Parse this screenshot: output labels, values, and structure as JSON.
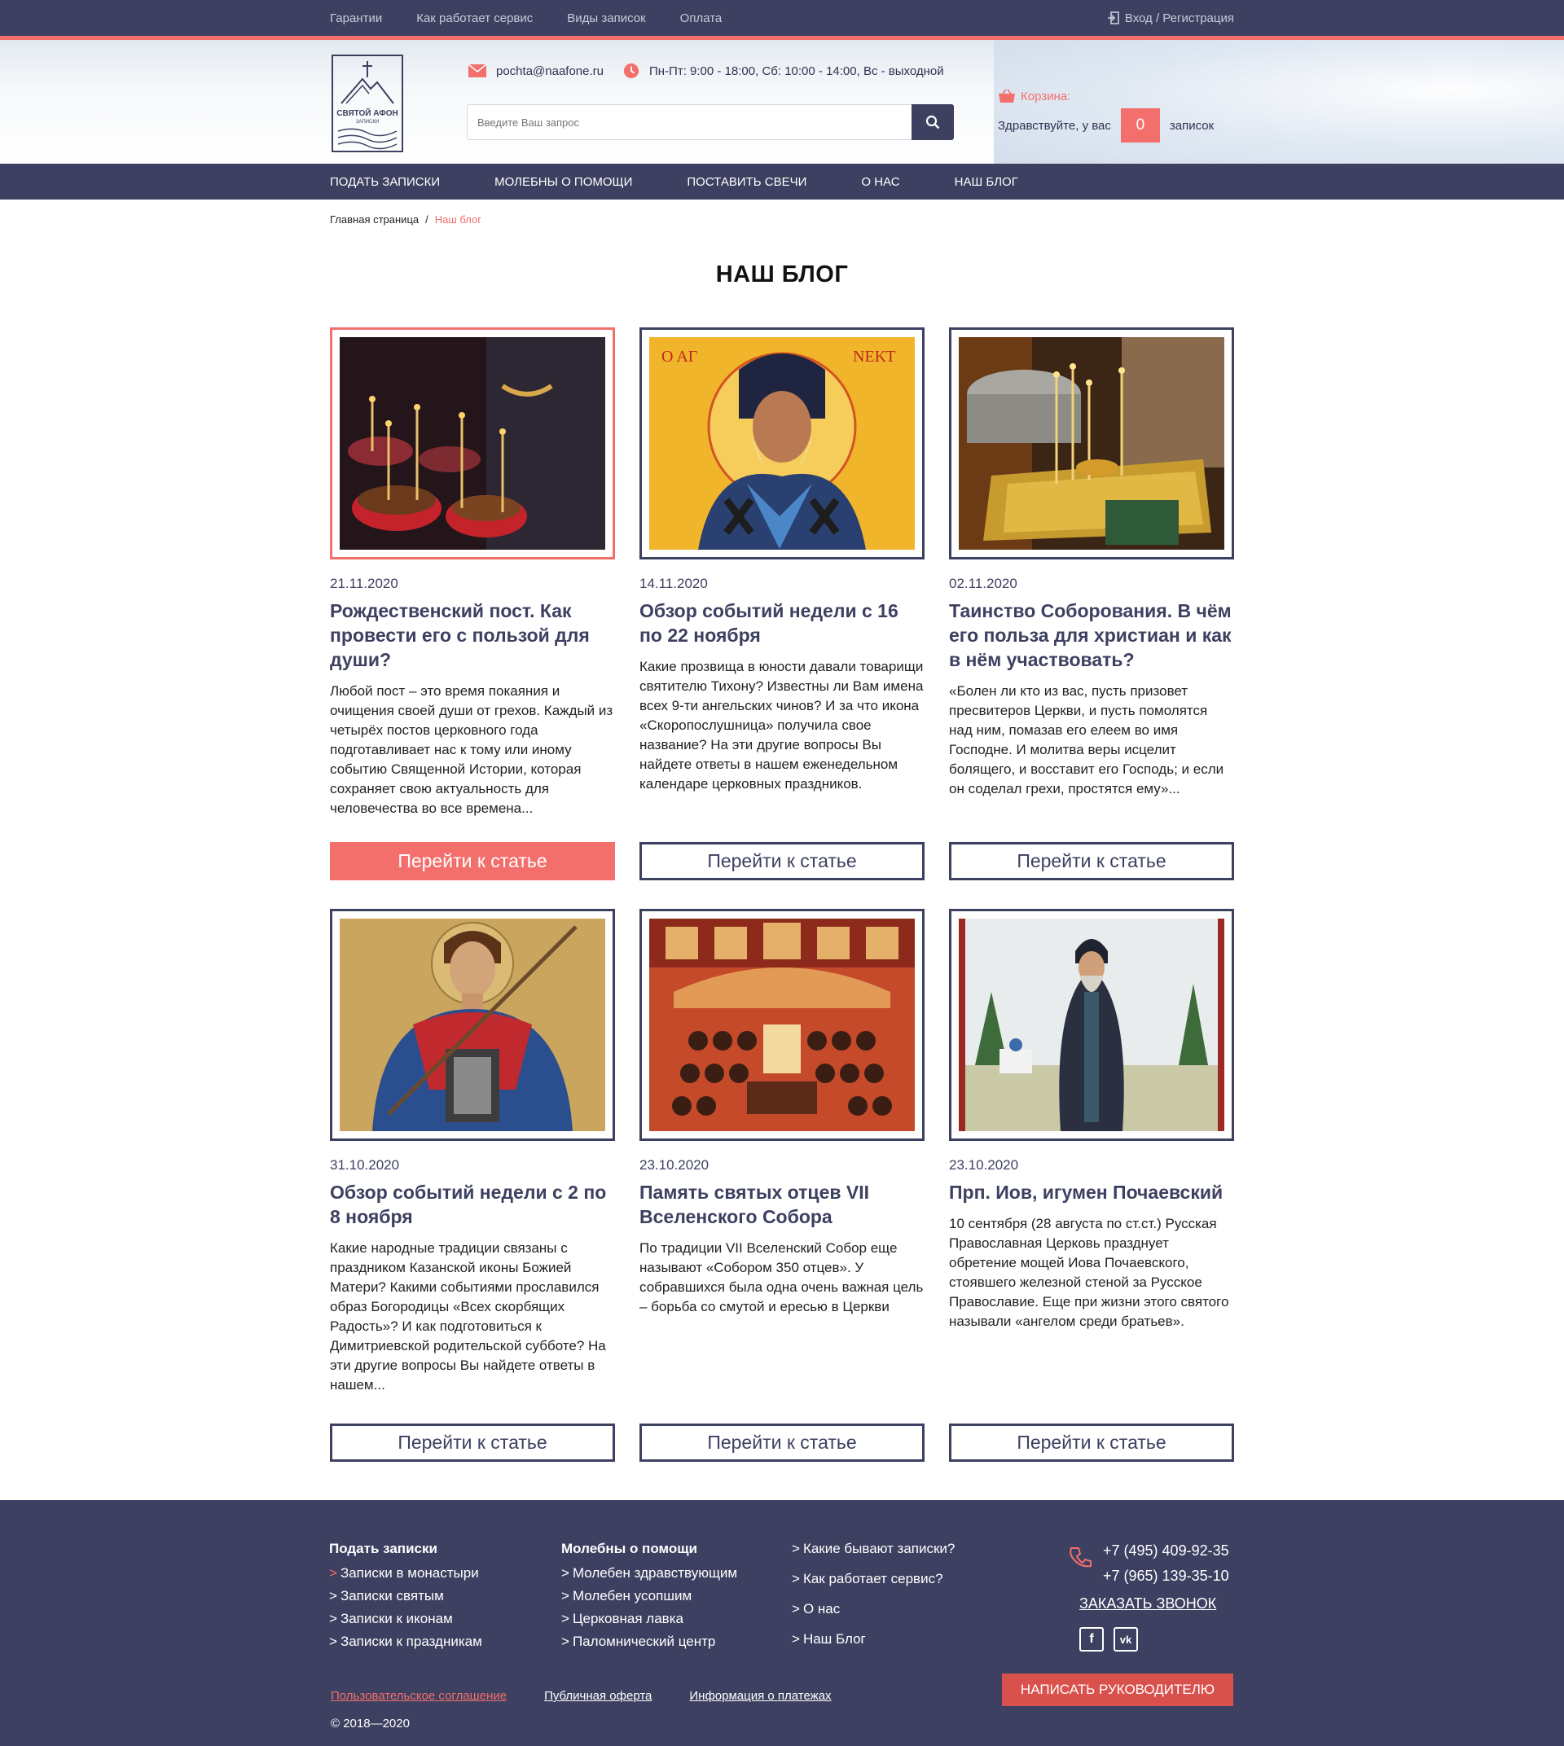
{
  "topbar": {
    "links": [
      "Гарантии",
      "Как работает сервис",
      "Виды записок",
      "Оплата"
    ],
    "login": "Вход / Регистрация"
  },
  "header": {
    "logo_text": "СВЯТОЙ АФОН",
    "logo_sub": "ЗАПИСКИ",
    "email": "pochta@naafone.ru",
    "hours": "Пн-Пт: 9:00 - 18:00, Сб: 10:00 - 14:00, Вс - выходной",
    "search_placeholder": "Введите Ваш запрос",
    "cart_title": "Корзина:",
    "cart_greeting": "Здравствуйте, у вас",
    "cart_count": "0",
    "cart_unit": "записок"
  },
  "nav": [
    "Подать записки",
    "Молебны о помощи",
    "Поставить свечи",
    "О нас",
    "Наш блог"
  ],
  "breadcrumb": {
    "home": "Главная страница",
    "sep": "/",
    "current": "Наш блог"
  },
  "page_title": "НАШ БЛОГ",
  "posts": [
    {
      "date": "21.11.2020",
      "title": "Рождественский пост. Как провести его с пользой для души?",
      "text": "Любой пост – это время покаяния и очищения своей души от грехов. Каждый из четырёх постов церковного года подготавливает нас к тому или иному событию Священной Истории, которая сохраняет свою актуальность для человечества во все времена...",
      "button": "Перейти к статье"
    },
    {
      "date": "14.11.2020",
      "title": "Обзор событий недели с 16 по 22 ноября",
      "text": "Какие прозвища в юности давали товарищи святителю Тихону? Известны ли Вам имена всех 9-ти ангельских чинов? И за что икона «Скоропослушница» получила свое название? На эти другие вопросы Вы найдете ответы в нашем еженедельном календаре церковных праздников.",
      "button": "Перейти к статье"
    },
    {
      "date": "02.11.2020",
      "title": "Таинство Соборования. В чём его польза для христиан и как в нём участвовать?",
      "text": "«Болен ли кто из вас, пусть призовет пресвитеров Церкви, и пусть помолятся над ним, помазав его елеем во имя Господне. И молитва веры исцелит болящего, и восставит его Господь; и если он соделал грехи, простятся ему»...",
      "button": "Перейти к статье"
    },
    {
      "date": "31.10.2020",
      "title": "Обзор событий недели с 2 по 8 ноября",
      "text": "Какие народные традиции связаны с праздником Казанской иконы Божией Матери? Какими событиями прославился образ Богородицы «Всех скорбящих Радость»? И как подготовиться к Димитриевской родительской субботе? На эти другие вопросы Вы найдете ответы в нашем...",
      "button": "Перейти к статье"
    },
    {
      "date": "23.10.2020",
      "title": "Память святых отцев VII Вселенского Собора",
      "text": "По традиции VII Вселенский Собор еще называют «Собором 350 отцев». У собравшихся была одна очень важная цель – борьба со смутой и ересью в Церкви",
      "button": "Перейти к статье"
    },
    {
      "date": "23.10.2020",
      "title": "Прп. Иов, игумен Почаевский",
      "text": "10 сентября (28 августа по ст.ст.) Русская Православная Церковь празднует обретение мощей Иова Почаевского, стоявшего железной стеной за Русское Православие. Еще при жизни этого святого называли «ангелом среди братьев».",
      "button": "Перейти к статье"
    }
  ],
  "footer": {
    "col1": {
      "head": "Подать записки",
      "items": [
        "Записки в монастыри",
        "Записки святым",
        "Записки к иконам",
        "Записки к праздникам"
      ]
    },
    "col2": {
      "head": "Молебны о помощи",
      "items": [
        "Молебен здравствующим",
        "Молебен усопшим",
        "Церковная лавка",
        "Паломнический центр"
      ]
    },
    "col3": {
      "items": [
        "Какие бывают записки?",
        "Как работает сервис?",
        "О нас",
        "Наш Блог"
      ]
    },
    "phone1": "+7 (495) 409-92-35",
    "phone2": "+7 (965) 139-35-10",
    "callback": "ЗАКАЗАТЬ ЗВОНОК",
    "write_boss": "Написать руководителю",
    "links": [
      "Пользовательское соглашение",
      "Публичная оферта",
      "Информация о платежах"
    ],
    "copyright": "© 2018—2020"
  },
  "colors": {
    "navy": "#3d4060",
    "accent": "#f36f6b"
  }
}
